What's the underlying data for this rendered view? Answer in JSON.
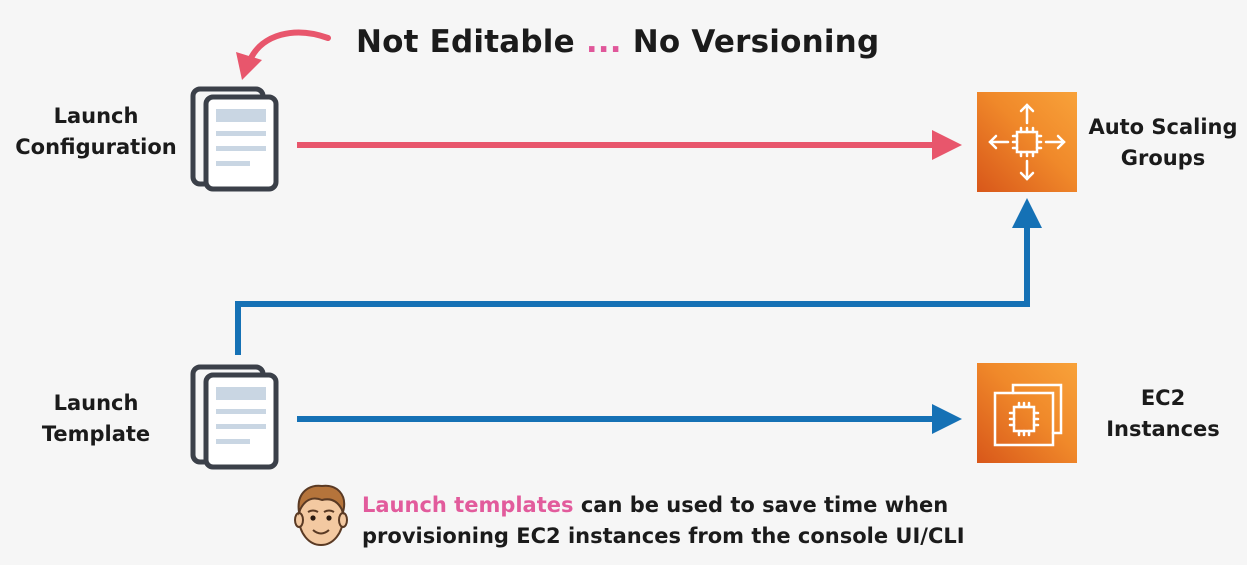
{
  "title": {
    "part1": "Not Editable",
    "dots": "...",
    "part2": "No Versioning"
  },
  "nodes": {
    "launch_configuration": {
      "line1": "Launch",
      "line2": "Configuration"
    },
    "launch_template": {
      "line1": "Launch",
      "line2": "Template"
    },
    "auto_scaling_groups": {
      "line1": "Auto Scaling",
      "line2": "Groups"
    },
    "ec2_instances": {
      "line1": "EC2",
      "line2": "Instances"
    }
  },
  "note": {
    "highlight": "Launch templates",
    "line1_rest": " can be used to save time when",
    "line2": "provisioning EC2 instances from the console UI/CLI"
  },
  "colors": {
    "red_arrow": "#e8566c",
    "blue_arrow": "#1571b5",
    "highlight": "#e25b9c",
    "aws_orange": "#f0892a"
  },
  "icons": [
    "document-stack-icon",
    "auto-scaling-icon",
    "ec2-instances-icon",
    "curved-arrow-icon",
    "avatar"
  ]
}
